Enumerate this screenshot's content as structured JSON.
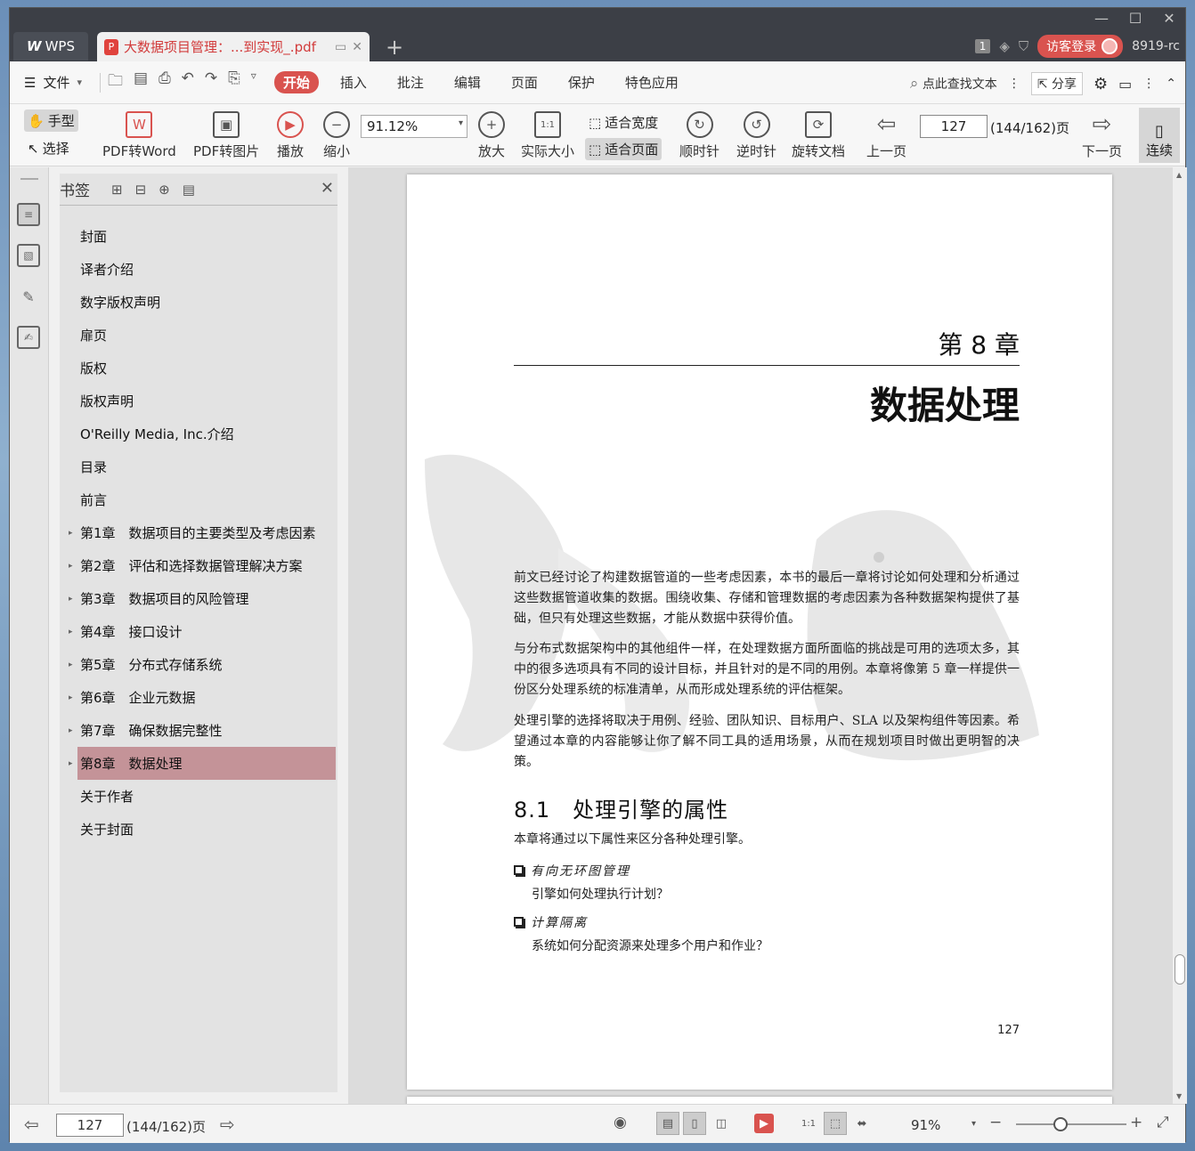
{
  "titlebar": {
    "wps_tab": "WPS",
    "doc_tab": "大数据项目管理：...到实现_.pdf",
    "page_badge": "1",
    "login": "访客登录",
    "account": "8919-rc"
  },
  "menu": {
    "file": "文件",
    "tabs": [
      "开始",
      "插入",
      "批注",
      "编辑",
      "页面",
      "保护",
      "特色应用"
    ],
    "active_tab": "开始",
    "search": "点此查找文本",
    "share": "分享"
  },
  "ribbon": {
    "hand": "手型",
    "select": "选择",
    "pdf_to_word": "PDF转Word",
    "pdf_to_image": "PDF转图片",
    "play": "播放",
    "zoom_out": "缩小",
    "zoom_value": "91.12%",
    "zoom_in": "放大",
    "actual_size": "实际大小",
    "fit_width": "适合宽度",
    "fit_page": "适合页面",
    "clockwise": "顺时针",
    "counter_clockwise": "逆时针",
    "rotate_doc": "旋转文档",
    "prev_page": "上一页",
    "page_input": "127",
    "page_count": "(144/162)页",
    "next_page": "下一页",
    "continuous": "连续"
  },
  "bookmarks": {
    "title": "书签",
    "items": [
      {
        "label": "封面",
        "arrow": false
      },
      {
        "label": "译者介绍",
        "arrow": false
      },
      {
        "label": "数字版权声明",
        "arrow": false
      },
      {
        "label": "扉页",
        "arrow": false
      },
      {
        "label": "版权",
        "arrow": false
      },
      {
        "label": "版权声明",
        "arrow": false
      },
      {
        "label": "O'Reilly Media, Inc.介绍",
        "arrow": false
      },
      {
        "label": "目录",
        "arrow": false
      },
      {
        "label": "前言",
        "arrow": false
      },
      {
        "label": "第1章　数据项目的主要类型及考虑因素",
        "arrow": true
      },
      {
        "label": "第2章　评估和选择数据管理解决方案",
        "arrow": true
      },
      {
        "label": "第3章　数据项目的风险管理",
        "arrow": true
      },
      {
        "label": "第4章　接口设计",
        "arrow": true
      },
      {
        "label": "第5章　分布式存储系统",
        "arrow": true
      },
      {
        "label": "第6章　企业元数据",
        "arrow": true
      },
      {
        "label": "第7章　确保数据完整性",
        "arrow": true
      },
      {
        "label": "第8章　数据处理",
        "arrow": true,
        "selected": true
      },
      {
        "label": "关于作者",
        "arrow": false
      },
      {
        "label": "关于封面",
        "arrow": false
      }
    ]
  },
  "page": {
    "chapter_number": "第 8 章",
    "chapter_title": "数据处理",
    "paragraphs": [
      "前文已经讨论了构建数据管道的一些考虑因素，本书的最后一章将讨论如何处理和分析通过这些数据管道收集的数据。围绕收集、存储和管理数据的考虑因素为各种数据架构提供了基础，但只有处理这些数据，才能从数据中获得价值。",
      "与分布式数据架构中的其他组件一样，在处理数据方面所面临的挑战是可用的选项太多，其中的很多选项具有不同的设计目标，并且针对的是不同的用例。本章将像第 5 章一样提供一份区分处理系统的标准清单，从而形成处理系统的评估框架。",
      "处理引擎的选择将取决于用例、经验、团队知识、目标用户、SLA 以及架构组件等因素。希望通过本章的内容能够让你了解不同工具的适用场景，从而在规划项目时做出更明智的决策。"
    ],
    "section_title": "8.1　处理引擎的属性",
    "section_intro": "本章将通过以下属性来区分各种处理引擎。",
    "list": [
      {
        "head": "有向无环图管理",
        "desc": "引擎如何处理执行计划？"
      },
      {
        "head": "计算隔离",
        "desc": "系统如何分配资源来处理多个用户和作业？"
      }
    ],
    "page_number": "127"
  },
  "status": {
    "page_input": "127",
    "page_count": "(144/162)页",
    "zoom": "91%"
  }
}
